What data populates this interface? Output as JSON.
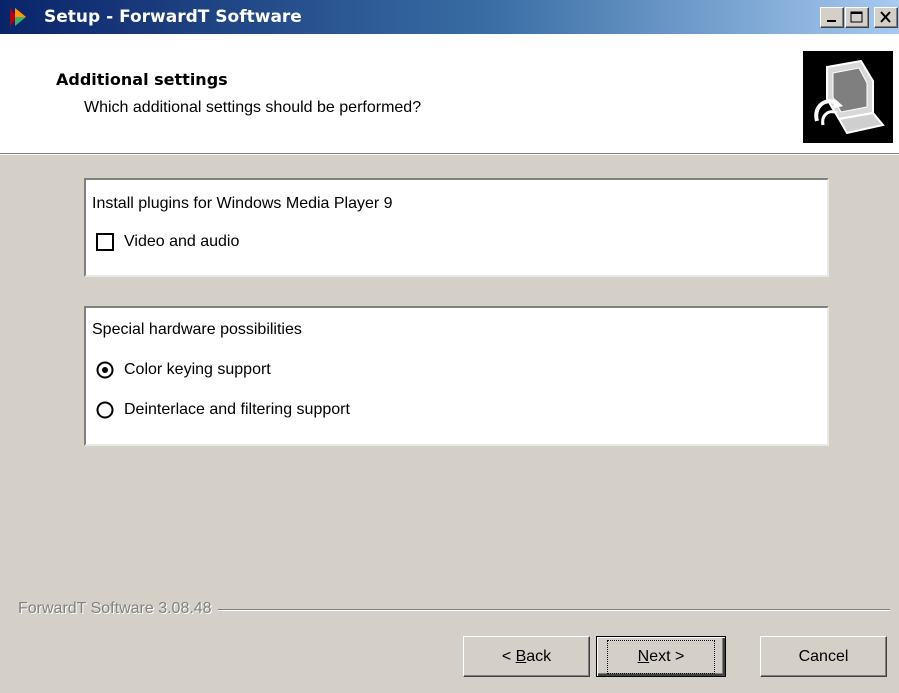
{
  "window": {
    "title": "Setup - ForwardT Software",
    "controls": [
      "minimize-icon",
      "maximize-icon",
      "close-icon"
    ]
  },
  "header": {
    "title": "Additional settings",
    "subtitle": "Which additional settings should be performed?",
    "image_icon": "computer-install-icon"
  },
  "groups": [
    {
      "title": "Install plugins for Windows Media Player 9",
      "options": [
        {
          "type": "checkbox",
          "label": "Video and audio",
          "checked": false
        }
      ]
    },
    {
      "title": "Special hardware possibilities",
      "options": [
        {
          "type": "radio",
          "label": "Color keying support",
          "selected": true
        },
        {
          "type": "radio",
          "label": "Deinterlace and filtering support",
          "selected": false
        }
      ]
    }
  ],
  "footer": {
    "version_label": "ForwardT Software 3.08.48",
    "back_accel": "B",
    "back_rest": "ack",
    "back_prefix": "< ",
    "next_accel": "N",
    "next_rest": "ext >",
    "cancel_label": "Cancel"
  },
  "colors": {
    "title_bar_start": "#0a246a",
    "title_bar_end": "#a6caf0",
    "dialog_face": "#d4d0c8",
    "panel_white": "#ffffff"
  }
}
